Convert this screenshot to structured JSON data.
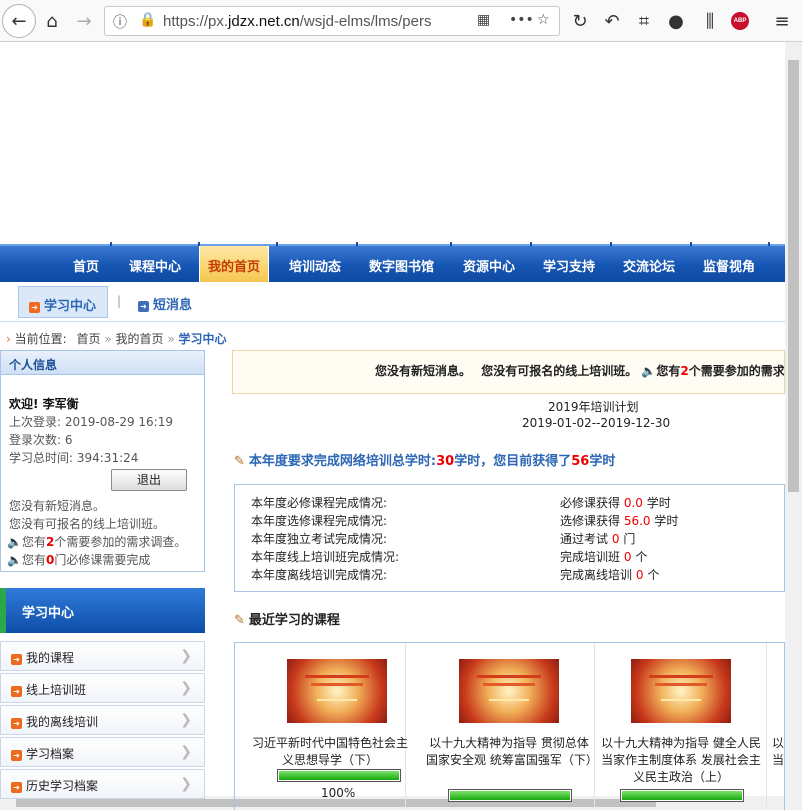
{
  "browser": {
    "url_prefix": "https://px.",
    "url_domain": "jdzx.net.cn",
    "url_path": "/wsjd-elms/lms/pers",
    "abp_label": "ABP"
  },
  "nav": {
    "items": [
      "首页",
      "课程中心",
      "我的首页",
      "培训动态",
      "数字图书馆",
      "资源中心",
      "学习支持",
      "交流论坛",
      "监督视角"
    ],
    "active": "我的首页"
  },
  "subnav": {
    "tabs": [
      "学习中心",
      "短消息"
    ],
    "separator": "|"
  },
  "breadcrumb": {
    "prefix": "当前位置:",
    "items": [
      "首页",
      "我的首页",
      "学习中心"
    ],
    "sep": "»"
  },
  "user_info": {
    "header": "个人信息",
    "welcome": "欢迎! 李军衡",
    "last_login": "上次登录: 2019-08-29 16:19",
    "login_count": "登录次数: 6",
    "total_time": "学习总时间: 394:31:24",
    "logout_label": "退出",
    "msg_none": "您没有新短消息。",
    "class_none": "您没有可报名的线上培训班。",
    "survey_pre": "您有",
    "survey_num": "2",
    "survey_post": "个需要参加的需求调查。",
    "required_pre": "您有",
    "required_num": "0",
    "required_post": "门必修课需要完成"
  },
  "learning_center": {
    "header": "学习中心",
    "menu": [
      "我的课程",
      "线上培训班",
      "我的离线培训",
      "学习档案",
      "历史学习档案"
    ]
  },
  "notice": {
    "text1": "您没有新短消息。",
    "text2": "您没有可报名的线上培训班。",
    "text3_pre": "您有",
    "text3_num": "2",
    "text3_post": "个需要参加的需求调"
  },
  "plan": {
    "title": "2019年培训计划",
    "dates": "2019-01-02--2019-12-30"
  },
  "requirement": {
    "pre": "本年度要求完成网络培训总学时:",
    "required": "30",
    "mid": "学时，您目前获得了",
    "obtained": "56",
    "post": "学时"
  },
  "stats": {
    "left": [
      "本年度必修课程完成情况:",
      "本年度选修课程完成情况:",
      "本年度独立考试完成情况:",
      "本年度线上培训班完成情况:",
      "本年度离线培训完成情况:"
    ],
    "right": [
      {
        "label": "必修课获得",
        "value": "0.0",
        "unit": "学时"
      },
      {
        "label": "选修课获得",
        "value": "56.0",
        "unit": "学时"
      },
      {
        "label": "通过考试",
        "value": "0",
        "unit": "门"
      },
      {
        "label": "完成培训班",
        "value": "0",
        "unit": "个"
      },
      {
        "label": "完成离线培训",
        "value": "0",
        "unit": "个"
      }
    ]
  },
  "recent": {
    "title": "最近学习的课程",
    "courses": [
      {
        "title": "习近平新时代中国特色社会主义思想导学（下）",
        "progress": 1.0,
        "percent_label": "100%"
      },
      {
        "title": "以十九大精神为指导 贯彻总体国家安全观 统筹富国强军（下）",
        "progress": 1.0
      },
      {
        "title": "以十九大精神为指导 健全人民当家作主制度体系 发展社会主义民主政治（上）",
        "progress": 1.0
      },
      {
        "title": "以当"
      }
    ]
  },
  "colors": {
    "nav_blue": "#1655b3",
    "active_tab": "#f5c64e",
    "accent_red": "#e00000",
    "link_blue": "#2d67b5"
  }
}
